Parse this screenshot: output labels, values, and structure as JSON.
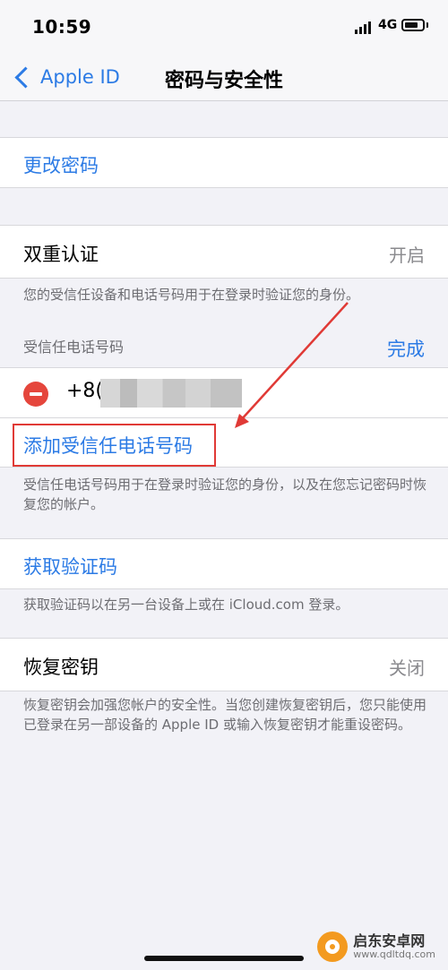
{
  "status_bar": {
    "time": "10:59",
    "network": "4G"
  },
  "nav": {
    "back_label": "Apple ID",
    "title": "密码与安全性"
  },
  "change_password": {
    "label": "更改密码"
  },
  "two_factor": {
    "label": "双重认证",
    "value": "开启",
    "footer": "您的受信任设备和电话号码用于在登录时验证您的身份。",
    "trusted_header": "受信任电话号码",
    "done_label": "完成",
    "phone_prefix": "+8(",
    "add_label": "添加受信任电话号码",
    "add_footer": "受信任电话号码用于在登录时验证您的身份，以及在您忘记密码时恢复您的帐户。"
  },
  "verification": {
    "label": "获取验证码",
    "footer": "获取验证码以在另一台设备上或在 iCloud.com 登录。"
  },
  "recovery_key": {
    "label": "恢复密钥",
    "value": "关闭",
    "footer": "恢复密钥会加强您帐户的安全性。当您创建恢复密钥后，您只能使用已登录在另一部设备的 Apple ID 或输入恢复密钥才能重设密码。"
  },
  "watermark": {
    "name": "启东安卓网",
    "url": "www.qdltdq.com"
  },
  "colors": {
    "accent": "#2c7be5",
    "delete": "#e5463c",
    "annotation": "#e03a36",
    "background": "#f2f2f7"
  }
}
